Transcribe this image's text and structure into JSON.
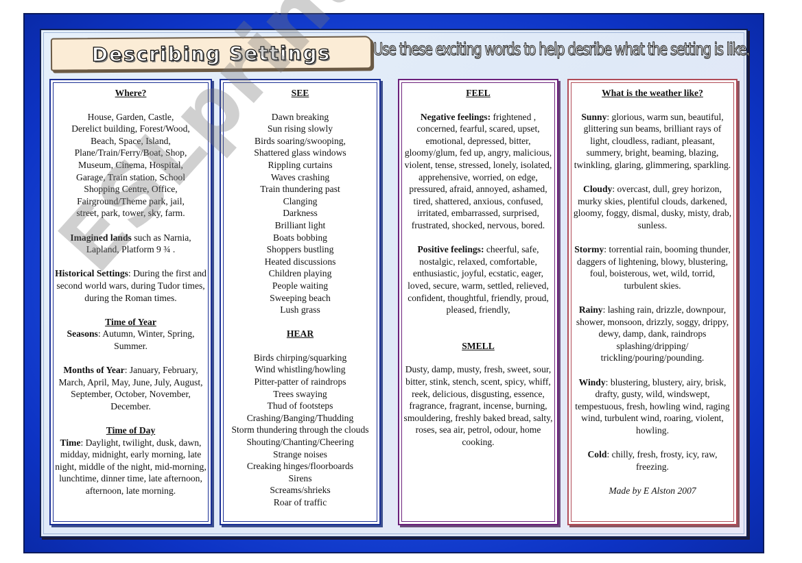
{
  "header": {
    "title": "Describing Settings",
    "subtitle": "Use these exciting words to help desribe what the setting is like."
  },
  "colors": {
    "frame_blue": "#1f4fe0",
    "blue_border": "#1a2f95",
    "purple_border": "#6b1f7a",
    "red_border": "#b04a55",
    "banner_bg": "#fbecd6"
  },
  "where": {
    "heading": "Where?",
    "places": [
      "House, Garden, Castle,",
      "Derelict building, Forest/Wood,",
      "Beach, Space, Island,",
      "Plane/Train/Ferry/Boat, Shop,",
      "Museum, Cinema, Hospital,",
      "Garage, Train station, School",
      "Shopping Centre, Office,",
      "Fairground/Theme park, jail,",
      "street, park, tower, sky, farm."
    ],
    "imagined_label": "Imagined lands",
    "imagined_text": " such as Narnia, Lapland, Platform 9 ¾ .",
    "historical_label": "Historical Settings",
    "historical_text": ": During the first and second world wars, during Tudor times, during the Roman times.",
    "time_of_year_heading": "Time of Year",
    "seasons_label": "Seasons",
    "seasons_text": ": Autumn, Winter, Spring, Summer.",
    "months_label": "Months of Year",
    "months_text": ": January, February, March, April, May, June, July, August, September, October, November, December.",
    "time_of_day_heading": "Time of Day",
    "time_label": "Time",
    "time_text": ": Daylight, twilight, dusk, dawn, midday, midnight, early morning, late night, middle of the night, mid-morning, lunchtime, dinner time, late afternoon, afternoon, late morning."
  },
  "see": {
    "heading": "SEE",
    "items": [
      "Dawn breaking",
      "Sun rising slowly",
      "Birds soaring/swooping,",
      "Shattered glass windows",
      "Rippling curtains",
      "Waves crashing",
      "Train thundering past",
      "Clanging",
      "Darkness",
      "Brilliant light",
      "Boats bobbing",
      "Shoppers bustling",
      "Heated discussions",
      "Children playing",
      "People waiting",
      "Sweeping beach",
      "Lush grass"
    ]
  },
  "hear": {
    "heading": "HEAR",
    "items": [
      "Birds chirping/squarking",
      "Wind whistling/howling",
      "Pitter-patter of raindrops",
      "Trees swaying",
      "Thud of footsteps",
      "Crashing/Banging/Thudding",
      "Storm thundering through the clouds",
      "Shouting/Chanting/Cheering",
      "Strange noises",
      "Creaking hinges/floorboards",
      "Sirens",
      "Screams/shrieks",
      "Roar of traffic"
    ]
  },
  "feel": {
    "heading": "FEEL",
    "negative_label": "Negative feelings:",
    "negative_text": " frightened , concerned, fearful, scared, upset, emotional, depressed, bitter, gloomy/glum, fed up, angry, malicious, violent, tense, stressed, lonely, isolated, apprehensive, worried, on edge, pressured, afraid, annoyed, ashamed, tired, shattered, anxious, confused, irritated, embarrassed, surprised, frustrated, shocked, nervous, bored.",
    "positive_label": "Positive feelings:",
    "positive_text": " cheerful, safe, nostalgic, relaxed, comfortable, enthusiastic, joyful, ecstatic, eager, loved, secure, warm, settled, relieved, confident, thoughtful, friendly, proud, pleased, friendly,"
  },
  "smell": {
    "heading": "SMELL",
    "text": "Dusty, damp, musty, fresh, sweet, sour, bitter, stink, stench, scent, spicy, whiff, reek, delicious, disgusting, essence, fragrance, fragrant, incense, burning, smouldering, freshly baked bread, salty, roses, sea air, petrol, odour, home cooking."
  },
  "weather": {
    "heading": "What is the weather like?",
    "sunny_label": "Sunny",
    "sunny_text": ": glorious, warm sun, beautiful, glittering sun beams, brilliant rays of light, cloudless, radiant, pleasant, summery, bright, beaming, blazing, twinkling, glaring, glimmering, sparkling.",
    "cloudy_label": "Cloudy",
    "cloudy_text": ": overcast, dull, grey horizon, murky skies, plentiful clouds, darkened, gloomy, foggy, dismal, dusky, misty, drab, sunless.",
    "stormy_label": "Stormy",
    "stormy_text": ": torrential rain, booming thunder, daggers of lightening, blowy, blustering, foul, boisterous, wet, wild, torrid, turbulent skies.",
    "rainy_label": "Rainy",
    "rainy_text": ": lashing rain, drizzle, downpour, shower, monsoon, drizzly, soggy, drippy, dewy, damp, dank, raindrops splashing/dripping/ trickling/pouring/pounding.",
    "windy_label": "Windy",
    "windy_text": ": blustering, blustery, airy, brisk, drafty, gusty, wild, windswept, tempestuous, fresh, howling wind, raging wind, turbulent wind, roaring, violent, howling.",
    "cold_label": "Cold",
    "cold_text": ": chilly, fresh, frosty, icy, raw, freezing.",
    "credit": "Made by E Alston 2007"
  },
  "watermark": "ESLprintables.com"
}
